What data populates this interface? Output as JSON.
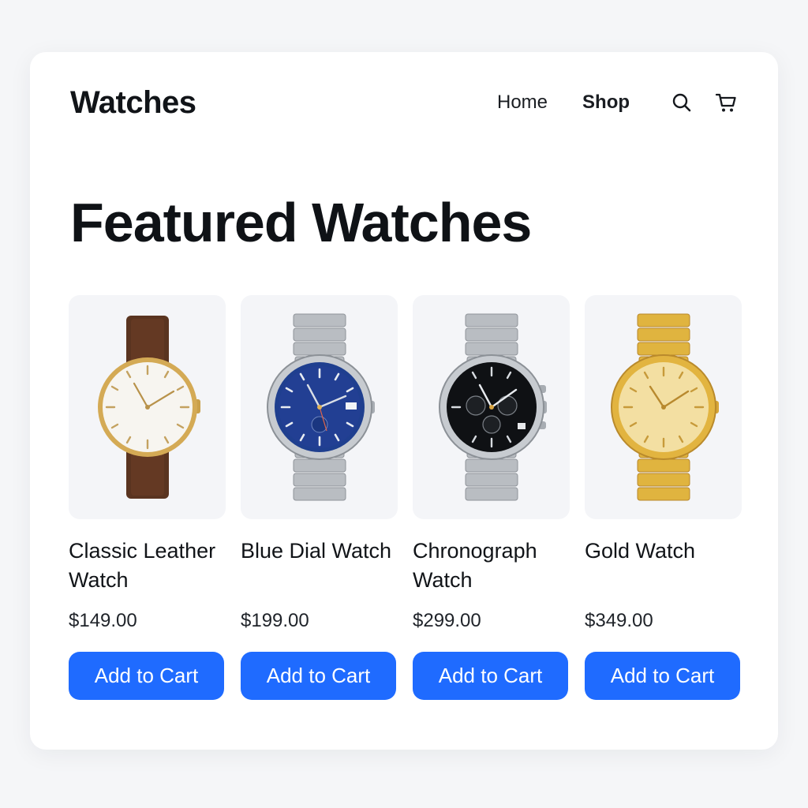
{
  "header": {
    "brand": "Watches",
    "nav": [
      {
        "label": "Home"
      },
      {
        "label": "Shop"
      }
    ],
    "icons": {
      "search": "search-icon",
      "cart": "cart-icon"
    }
  },
  "page_title": "Featured Watches",
  "products": [
    {
      "name": "Classic Leather Watch",
      "price": "$149.00",
      "cta": "Add to Cart",
      "image": "watch-leather-gold-white-dial"
    },
    {
      "name": "Blue Dial Watch",
      "price": "$199.00",
      "cta": "Add to Cart",
      "image": "watch-steel-blue-dial"
    },
    {
      "name": "Chronograph Watch",
      "price": "$299.00",
      "cta": "Add to Cart",
      "image": "watch-steel-black-chronograph"
    },
    {
      "name": "Gold Watch",
      "price": "$349.00",
      "cta": "Add to Cart",
      "image": "watch-gold-champagne-dial"
    }
  ],
  "colors": {
    "accent": "#1f6bff",
    "text": "#111418",
    "tile": "#f4f5f8",
    "background": "#f5f6f8"
  }
}
